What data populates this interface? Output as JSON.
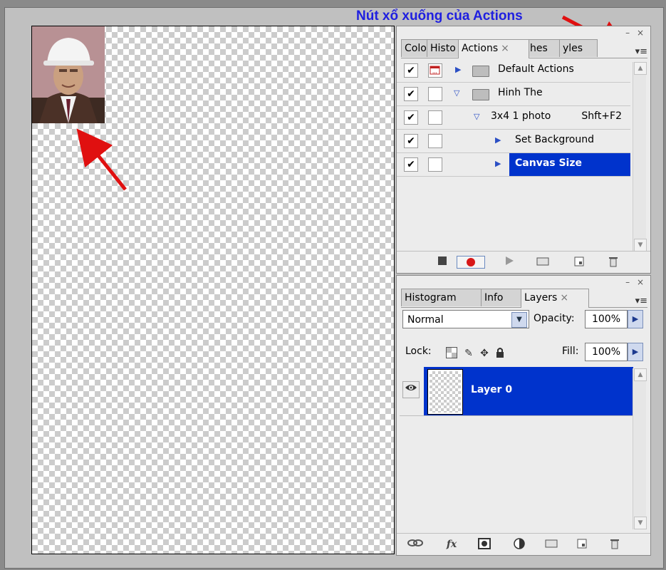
{
  "annotation": {
    "text": "Nút xổ xuống của Actions"
  },
  "actions_panel": {
    "tabs": [
      {
        "label": "Colo",
        "active": false
      },
      {
        "label": "Histo",
        "active": false
      },
      {
        "label": "Actions",
        "active": true
      },
      {
        "label": "hes",
        "active": false
      },
      {
        "label": "yles",
        "active": false
      }
    ],
    "close_glyph": "×",
    "window_buttons": "– ×",
    "menu_glyph": "▾≡",
    "rows": [
      {
        "checked": "✔",
        "dialog": true,
        "expanded": false,
        "folder": true,
        "label": "Default Actions",
        "shortcut": ""
      },
      {
        "checked": "✔",
        "dialog": false,
        "expanded": true,
        "folder": true,
        "label": "Hinh The",
        "shortcut": ""
      },
      {
        "checked": "✔",
        "dialog": false,
        "expanded": true,
        "folder": false,
        "label": "3x4 1 photo",
        "shortcut": "Shft+F2"
      },
      {
        "checked": "✔",
        "dialog": false,
        "expanded": false,
        "folder": false,
        "label": "Set Background",
        "shortcut": ""
      },
      {
        "checked": "✔",
        "dialog": false,
        "expanded": false,
        "folder": false,
        "label": "Canvas Size",
        "shortcut": "",
        "selected": true
      }
    ],
    "toolbar_icons": [
      "stop-icon",
      "record-icon",
      "play-icon",
      "new-set-icon",
      "new-action-icon",
      "delete-icon"
    ]
  },
  "layers_panel": {
    "tabs": [
      {
        "label": "Histogram",
        "active": false
      },
      {
        "label": "Info",
        "active": false
      },
      {
        "label": "Layers",
        "active": true
      }
    ],
    "close_glyph": "×",
    "window_buttons": "– ×",
    "menu_glyph": "▾≡",
    "blend_mode": "Normal",
    "opacity_label": "Opacity:",
    "opacity_value": "100%",
    "lock_label": "Lock:",
    "fill_label": "Fill:",
    "fill_value": "100%",
    "layer": {
      "name": "Layer 0",
      "visible": true,
      "selected": true
    },
    "toolbar_icons": [
      "link-icon",
      "fx-icon",
      "mask-icon",
      "adjustment-icon",
      "group-icon",
      "new-layer-icon",
      "delete-icon"
    ],
    "fx_text": "fx"
  },
  "colors": {
    "selection": "#0033cc",
    "annotation": "#1f1fe0",
    "arrow": "#e01010"
  }
}
